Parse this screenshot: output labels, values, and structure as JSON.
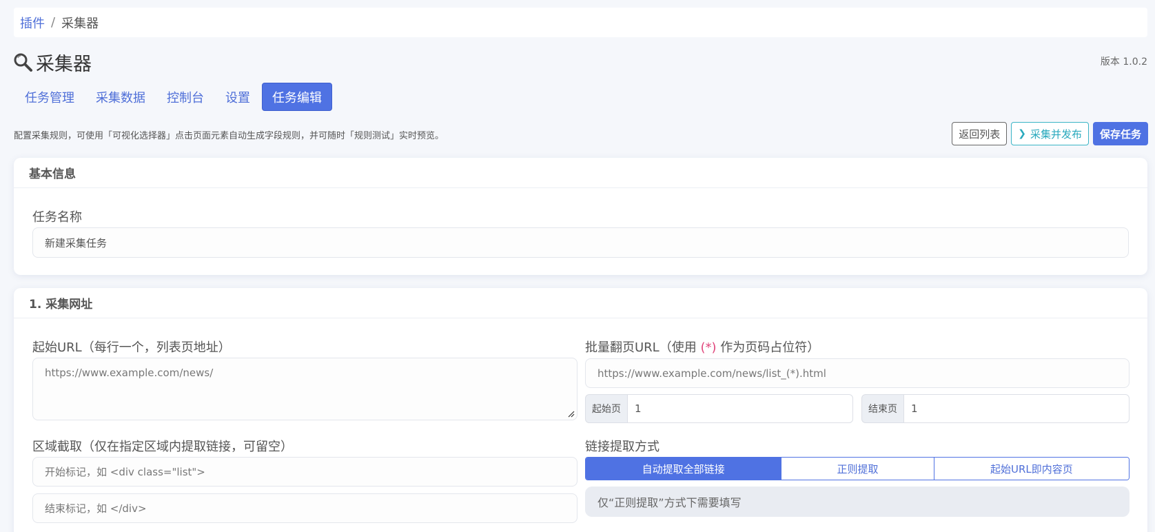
{
  "breadcrumb": {
    "link": "插件",
    "separator": "/",
    "current": "采集器"
  },
  "page": {
    "title": "采集器",
    "version": "版本 1.0.2",
    "icon": "search-icon"
  },
  "tabs": [
    {
      "label": "任务管理"
    },
    {
      "label": "采集数据"
    },
    {
      "label": "控制台"
    },
    {
      "label": "设置"
    },
    {
      "label": "任务编辑",
      "active": true
    }
  ],
  "hint": "配置采集规则，可使用「可视化选择器」点击页面元素自动生成字段规则，并可随时「规则测试」实时预览。",
  "actions": {
    "back": "返回列表",
    "collect_publish": "采集并发布",
    "save": "保存任务"
  },
  "basic": {
    "header": "基本信息",
    "task_name_label": "任务名称",
    "task_name_value": "新建采集任务"
  },
  "url_section": {
    "header": "1. 采集网址",
    "start_url_label": "起始URL（每行一个，列表页地址）",
    "start_url_placeholder": "https://www.example.com/news/",
    "batch_label_pre": "批量翻页URL（使用 ",
    "batch_label_token": "(*)",
    "batch_label_post": " 作为页码占位符）",
    "batch_placeholder": "https://www.example.com/news/list_(*).html",
    "start_page_label": "起始页",
    "start_page_value": "1",
    "end_page_label": "结束页",
    "end_page_value": "1",
    "region_label": "区域截取（仅在指定区域内提取链接，可留空）",
    "region_start_placeholder": "开始标记，如 <div class=\"list\">",
    "region_end_placeholder": "结束标记，如 </div>",
    "link_method_label": "链接提取方式",
    "link_methods": [
      "自动提取全部链接",
      "正则提取",
      "起始URL即内容页"
    ],
    "regex_placeholder": "仅“正则提取”方式下需要填写"
  },
  "colors": {
    "accent": "#4f72e3",
    "info": "#29a9bd",
    "required": "#e0457b"
  }
}
